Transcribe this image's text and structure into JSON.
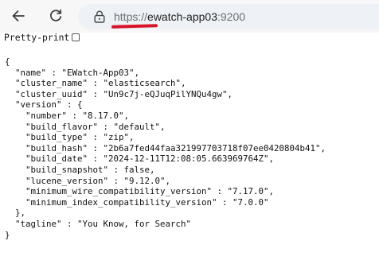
{
  "browser": {
    "url_scheme": "https://",
    "url_host": "ewatch-app03",
    "url_port": ":9200",
    "annotation_color": "#d8162a",
    "icons": {
      "back": "arrow-left-icon",
      "reload": "reload-icon",
      "site_info": "lock-icon"
    }
  },
  "pretty_print": {
    "label": "Pretty-print",
    "checked": false
  },
  "response": {
    "open_brace": "{",
    "name_line": "  \"name\" : \"EWatch-App03\",",
    "cluster_name_line": "  \"cluster_name\" : \"elasticsearch\",",
    "cluster_uuid_line": "  \"cluster_uuid\" : \"Un9c7j-eQJuqPilYNQu4gw\",",
    "version_open": "  \"version\" : {",
    "number_line": "    \"number\" : \"8.17.0\",",
    "build_flavor_line": "    \"build_flavor\" : \"default\",",
    "build_type_line": "    \"build_type\" : \"zip\",",
    "build_hash_line": "    \"build_hash\" : \"2b6a7fed44faa321997703718f07ee0420804b41\",",
    "build_date_line": "    \"build_date\" : \"2024-12-11T12:08:05.663969764Z\",",
    "build_snapshot_line": "    \"build_snapshot\" : false,",
    "lucene_version_line": "    \"lucene_version\" : \"9.12.0\",",
    "min_wire_line": "    \"minimum_wire_compatibility_version\" : \"7.17.0\",",
    "min_index_line": "    \"minimum_index_compatibility_version\" : \"7.0.0\"",
    "version_close": "  },",
    "tagline_line": "  \"tagline\" : \"You Know, for Search\"",
    "close_brace": "}"
  }
}
